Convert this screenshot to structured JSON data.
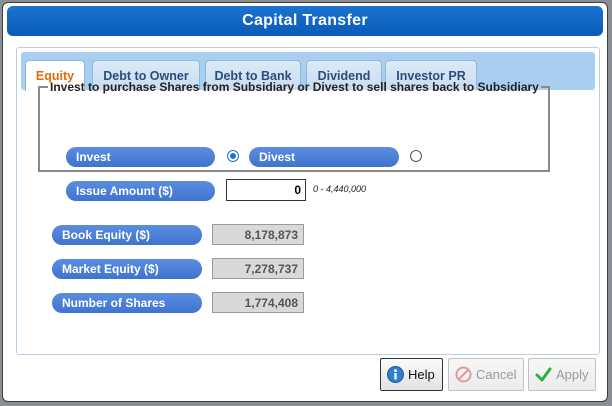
{
  "window": {
    "title": "Capital Transfer"
  },
  "tabs": [
    {
      "label": "Equity",
      "active": true
    },
    {
      "label": "Debt to Owner",
      "active": false
    },
    {
      "label": "Debt to Bank",
      "active": false
    },
    {
      "label": "Dividend",
      "active": false
    },
    {
      "label": "Investor PR",
      "active": false
    }
  ],
  "form": {
    "group_title": "Invest to purchase Shares from Subsidiary or Divest to sell shares back to Subsidiary",
    "invest_label": "Invest",
    "divest_label": "Divest",
    "selected_option": "Invest",
    "issue_amount_label": "Issue Amount ($)",
    "issue_amount_value": "0",
    "issue_amount_range": "0 - 4,440,000"
  },
  "stats": {
    "book_equity_label": "Book Equity ($)",
    "book_equity_value": "8,178,873",
    "market_equity_label": "Market Equity ($)",
    "market_equity_value": "7,278,737",
    "shares_label": "Number of Shares",
    "shares_value": "1,774,408"
  },
  "buttons": {
    "help": "Help",
    "cancel": "Cancel",
    "apply": "Apply"
  },
  "colors": {
    "title_bar": "#0a5ab8",
    "pill": "#4a7fd8",
    "active_tab_text": "#e06d0c",
    "tab_strip": "#a9cff0"
  },
  "icons": {
    "help": "info-icon",
    "cancel": "cancel-icon",
    "apply": "checkmark-icon"
  }
}
